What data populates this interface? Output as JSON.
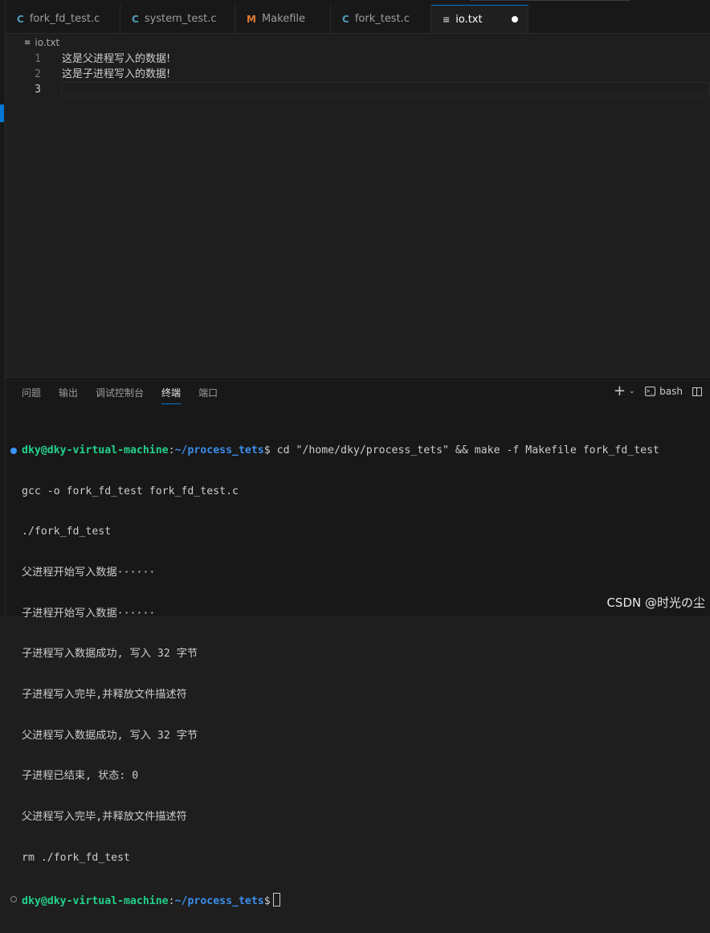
{
  "tabs": [
    {
      "icon": "C",
      "icon_name": "c-file-icon",
      "label": "fork_fd_test.c"
    },
    {
      "icon": "C",
      "icon_name": "c-file-icon",
      "label": "system_test.c"
    },
    {
      "icon": "M",
      "icon_name": "makefile-icon",
      "label": "Makefile"
    },
    {
      "icon": "C",
      "icon_name": "c-file-icon",
      "label": "fork_test.c"
    },
    {
      "icon": "≡",
      "icon_name": "text-file-icon",
      "label": "io.txt",
      "active": true,
      "dirty": true
    }
  ],
  "breadcrumb": {
    "icon": "≡",
    "label": "io.txt"
  },
  "editor": {
    "lines": [
      {
        "number": "1",
        "text": "这是父进程写入的数据!"
      },
      {
        "number": "2",
        "text": "这是子进程写入的数据!"
      },
      {
        "number": "3",
        "text": ""
      }
    ]
  },
  "panel": {
    "tabs": [
      "问题",
      "输出",
      "调试控制台",
      "终端",
      "端口"
    ],
    "active_tab": "终端",
    "shell_label": "bash",
    "plus_icon": "+",
    "chevron_icon": "⌄"
  },
  "terminal": {
    "prompt_user": "dky@dky-virtual-machine",
    "prompt_sep": ":",
    "prompt_path": "~/process_tets",
    "prompt_end": "$ ",
    "command": "cd \"/home/dky/process_tets\" && make -f Makefile fork_fd_test",
    "output": [
      "gcc -o fork_fd_test fork_fd_test.c",
      "./fork_fd_test",
      "父进程开始写入数据······",
      "子进程开始写入数据······",
      "子进程写入数据成功, 写入 32 字节",
      "子进程写入完毕,并释放文件描述符",
      "父进程写入数据成功, 写入 32 字节",
      "子进程已结束, 状态: 0",
      "父进程写入完毕,并释放文件描述符",
      "rm ./fork_fd_test"
    ],
    "final_prompt_end": "$"
  },
  "watermark": "CSDN @时光の尘",
  "colors": {
    "accent": "#0078d4",
    "prompt_user": "#23d18b",
    "prompt_path": "#3b8eea"
  }
}
